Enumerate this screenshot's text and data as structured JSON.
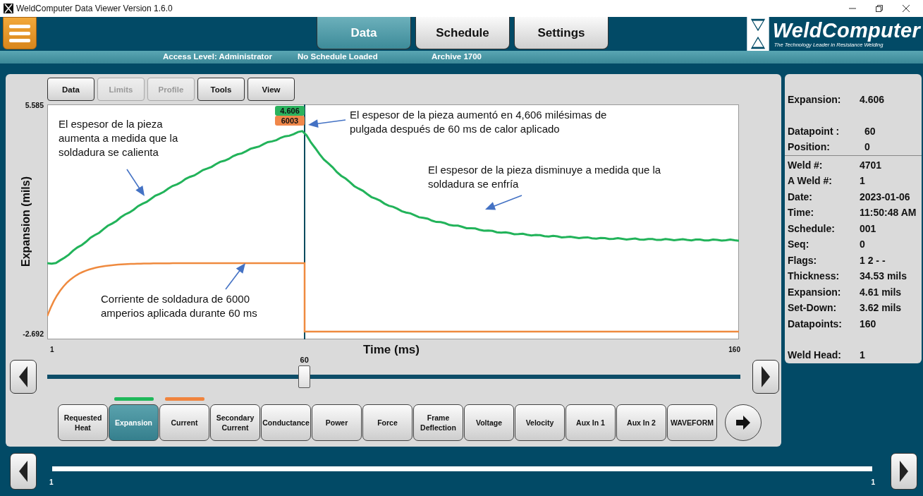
{
  "window": {
    "title": "WeldComputer Data Viewer Version 1.6.0"
  },
  "tabs": [
    {
      "label": "Data",
      "selected": true
    },
    {
      "label": "Schedule",
      "selected": false
    },
    {
      "label": "Settings",
      "selected": false
    }
  ],
  "logo": {
    "name": "WeldComputer",
    "tagline": "The Technology Leader in Resistance Welding"
  },
  "status_bar": [
    "Access Level: Administrator",
    "No Schedule Loaded",
    "Archive 1700"
  ],
  "toolbar": [
    {
      "label": "Data",
      "disabled": false
    },
    {
      "label": "Limits",
      "disabled": true
    },
    {
      "label": "Profile",
      "disabled": true
    },
    {
      "label": "Tools",
      "disabled": false
    },
    {
      "label": "View",
      "disabled": false
    }
  ],
  "chart": {
    "y_title": "Expansion (mils)",
    "y_max": "5.585",
    "y_min": "-2.692",
    "x_title": "Time (ms)",
    "x_start": "1",
    "x_end": "160",
    "cursor_values": [
      {
        "text": "4.606",
        "color": "#2bb25e"
      },
      {
        "text": "6003",
        "color": "#f0874a"
      }
    ],
    "annotations": [
      "El espesor de la pieza aumenta a medida que la soldadura se calienta",
      "El espesor de la pieza aumentó en 4,606 milésimas de pulgada después de 60 ms de calor aplicado",
      "El espesor de la pieza disminuye a medida que la soldadura se enfría",
      "Corriente de soldadura de 6000 amperios aplicada durante 60 ms"
    ]
  },
  "slider": {
    "reading": "60",
    "level": 0.371
  },
  "channels": [
    {
      "label": "Requested Heat",
      "selected": false
    },
    {
      "label": "Expansion",
      "selected": true,
      "color": "#1fb85a"
    },
    {
      "label": "Current",
      "selected": false,
      "color": "#f0843e"
    },
    {
      "label": "Secondary Current",
      "selected": false
    },
    {
      "label": "Conductance",
      "selected": false
    },
    {
      "label": "Power",
      "selected": false
    },
    {
      "label": "Force",
      "selected": false
    },
    {
      "label": "Frame Deflection",
      "selected": false
    },
    {
      "label": "Voltage",
      "selected": false
    },
    {
      "label": "Velocity",
      "selected": false
    },
    {
      "label": "Aux In 1",
      "selected": false
    },
    {
      "label": "Aux In 2",
      "selected": false
    },
    {
      "label": "WAVEFORM",
      "selected": false
    }
  ],
  "readout": {
    "summary": [
      {
        "label": "Expansion:",
        "value": "4.606"
      }
    ],
    "cursor": [
      {
        "label": "Datapoint :",
        "value": "60"
      },
      {
        "label": "Position:",
        "value": "0"
      }
    ],
    "weld": [
      {
        "label": "Weld #:",
        "value": "4701"
      },
      {
        "label": "A Weld #:",
        "value": "1"
      },
      {
        "label": "Date:",
        "value": "2023-01-06"
      },
      {
        "label": "Time:",
        "value": "11:50:48 AM"
      },
      {
        "label": "Schedule:",
        "value": "001"
      },
      {
        "label": "Seq:",
        "value": "0"
      },
      {
        "label": "Flags:",
        "value": "1 2 - -"
      },
      {
        "label": "Thickness:",
        "value": "34.53 mils"
      },
      {
        "label": "Expansion:",
        "value": "4.61 mils"
      },
      {
        "label": "Set-Down:",
        "value": "3.62 mils"
      },
      {
        "label": "Datapoints:",
        "value": "160"
      }
    ],
    "head": [
      {
        "label": "Weld Head:",
        "value": "1"
      }
    ]
  },
  "navigator": {
    "start": "1",
    "end": "1"
  }
}
